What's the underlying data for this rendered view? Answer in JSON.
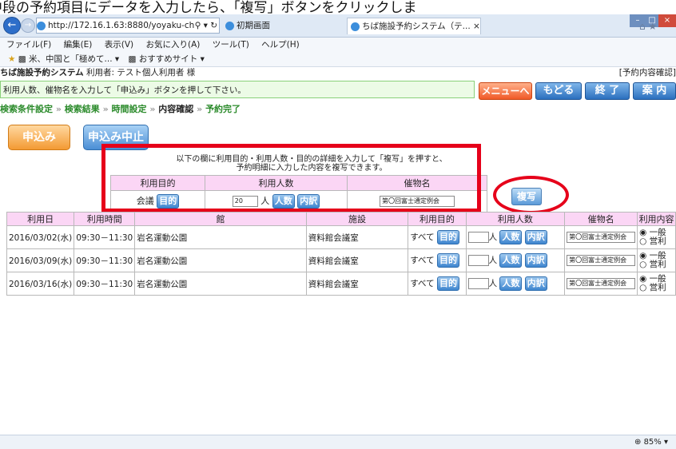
{
  "caption": "中段の予約項目にデータを入力したら、「複写」ボタンをクリックしま",
  "browser": {
    "url": "http://172.16.1.63:8880/yoyaku-ch",
    "tab1_label": "初期画面",
    "tab2_label": "ちば施設予約システム（テ...",
    "menu": [
      "ファイル(F)",
      "編集(E)",
      "表示(V)",
      "お気に入り(A)",
      "ツール(T)",
      "ヘルプ(H)"
    ],
    "favorites": [
      "米、中国と「極めて...",
      "おすすめサイト"
    ],
    "zoom": "85%"
  },
  "header": {
    "system_name": "ちば施設予約システム",
    "user_label": "利用者: テスト個人利用者 様",
    "page_label": "[予約内容確認]",
    "instruction": "利用人数、催物名を入力して「申込み」ボタンを押して下さい。",
    "buttons": {
      "menu": "メニューへ",
      "back": "もどる",
      "end": "終 了",
      "guide": "案 内"
    }
  },
  "breadcrumb": [
    "検索条件設定",
    "検索結果",
    "時間設定",
    "内容確認",
    "予約完了"
  ],
  "actions": {
    "apply": "申込み",
    "cancel": "申込み中止"
  },
  "copy_section": {
    "instruction_line1": "以下の欄に利用目的・利用人数・目的の詳細を入力して「複写」を押すと、",
    "instruction_line2": "予約明細に入力した内容を複写できます。",
    "headers": [
      "利用目的",
      "利用人数",
      "催物名"
    ],
    "purpose": "会議",
    "purpose_btn": "目的",
    "count": "20",
    "count_unit": "人",
    "count_btn1": "人数",
    "count_btn2": "内訳",
    "event": "第〇回富士通定例会",
    "copy_btn": "複写"
  },
  "table": {
    "headers": [
      "利用日",
      "利用時間",
      "館",
      "施設",
      "利用目的",
      "利用人数",
      "催物名",
      "利用内容"
    ],
    "rows": [
      {
        "date": "2016/03/02(水)",
        "time": "09:30－11:30",
        "hall": "岩名運動公園",
        "facility": "資料館会議室",
        "purpose": "すべて",
        "event": "第〇回富士通定例会"
      },
      {
        "date": "2016/03/09(水)",
        "time": "09:30－11:30",
        "hall": "岩名運動公園",
        "facility": "資料館会議室",
        "purpose": "すべて",
        "event": "第〇回富士通定例会"
      },
      {
        "date": "2016/03/16(水)",
        "time": "09:30－11:30",
        "hall": "岩名運動公園",
        "facility": "資料館会議室",
        "purpose": "すべて",
        "event": "第〇回富士通定例会"
      }
    ],
    "purpose_btn": "目的",
    "count_unit": "人",
    "count_btn1": "人数",
    "count_btn2": "内訳",
    "radio1": "一般",
    "radio2": "営利"
  }
}
